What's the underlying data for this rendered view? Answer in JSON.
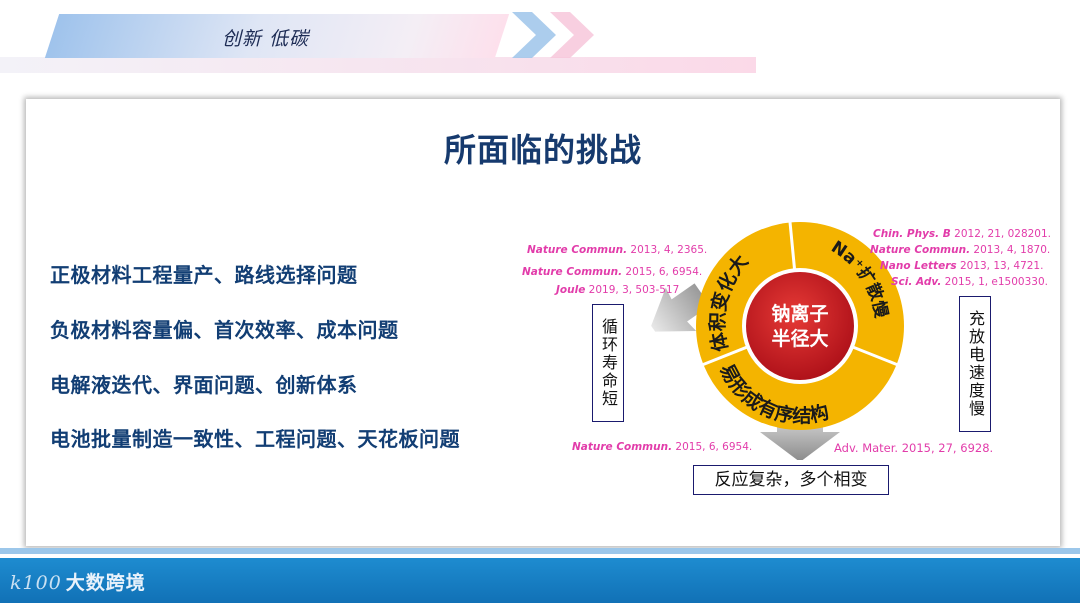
{
  "header": {
    "tagline": "创新 低碳"
  },
  "slide": {
    "title": "所面临的挑战",
    "challenges": [
      "正极材料工程量产、路线选择问题",
      "负极材料容量偏、首次效率、成本问题",
      "电解液迭代、界面问题、创新体系",
      "电池批量制造一致性、工程问题、天花板问题"
    ]
  },
  "diagram": {
    "center": [
      "钠离子",
      "半径大"
    ],
    "segments": {
      "left": "体积变化大",
      "right": "Na⁺扩散慢",
      "bottom": "易形成有序结构"
    },
    "left_box": "循环寿命短",
    "right_box": "充放电速度慢",
    "bottom_box": "反应复杂，多个相变",
    "refs_left": [
      {
        "j": "Nature Commun.",
        "c": " 2013, 4, 2365."
      },
      {
        "j": "Nature Commun.",
        "c": " 2015, 6, 6954."
      },
      {
        "j": "Joule",
        "c": " 2019, 3, 503-517"
      }
    ],
    "refs_right": [
      {
        "j": "Chin. Phys. B",
        "c": " 2012, 21, 028201."
      },
      {
        "j": "Nature Commun.",
        "c": "  2013, 4, 1870."
      },
      {
        "j": "Nano Letters",
        "c": " 2013, 13, 4721."
      },
      {
        "j": "Sci. Adv.",
        "c": " 2015, 1, e1500330."
      }
    ],
    "ref_bottom_left": {
      "j": "Nature Commun.",
      "c": " 2015, 6, 6954."
    },
    "ref_bottom_right": {
      "j": "",
      "c": "Adv. Mater. 2015, 27, 6928."
    },
    "colors": {
      "ring": "#f4b400",
      "core": "#c8141c",
      "label": "#e23caa"
    }
  },
  "footer": {
    "brand": "大数跨境",
    "logo_mark": "k100"
  }
}
